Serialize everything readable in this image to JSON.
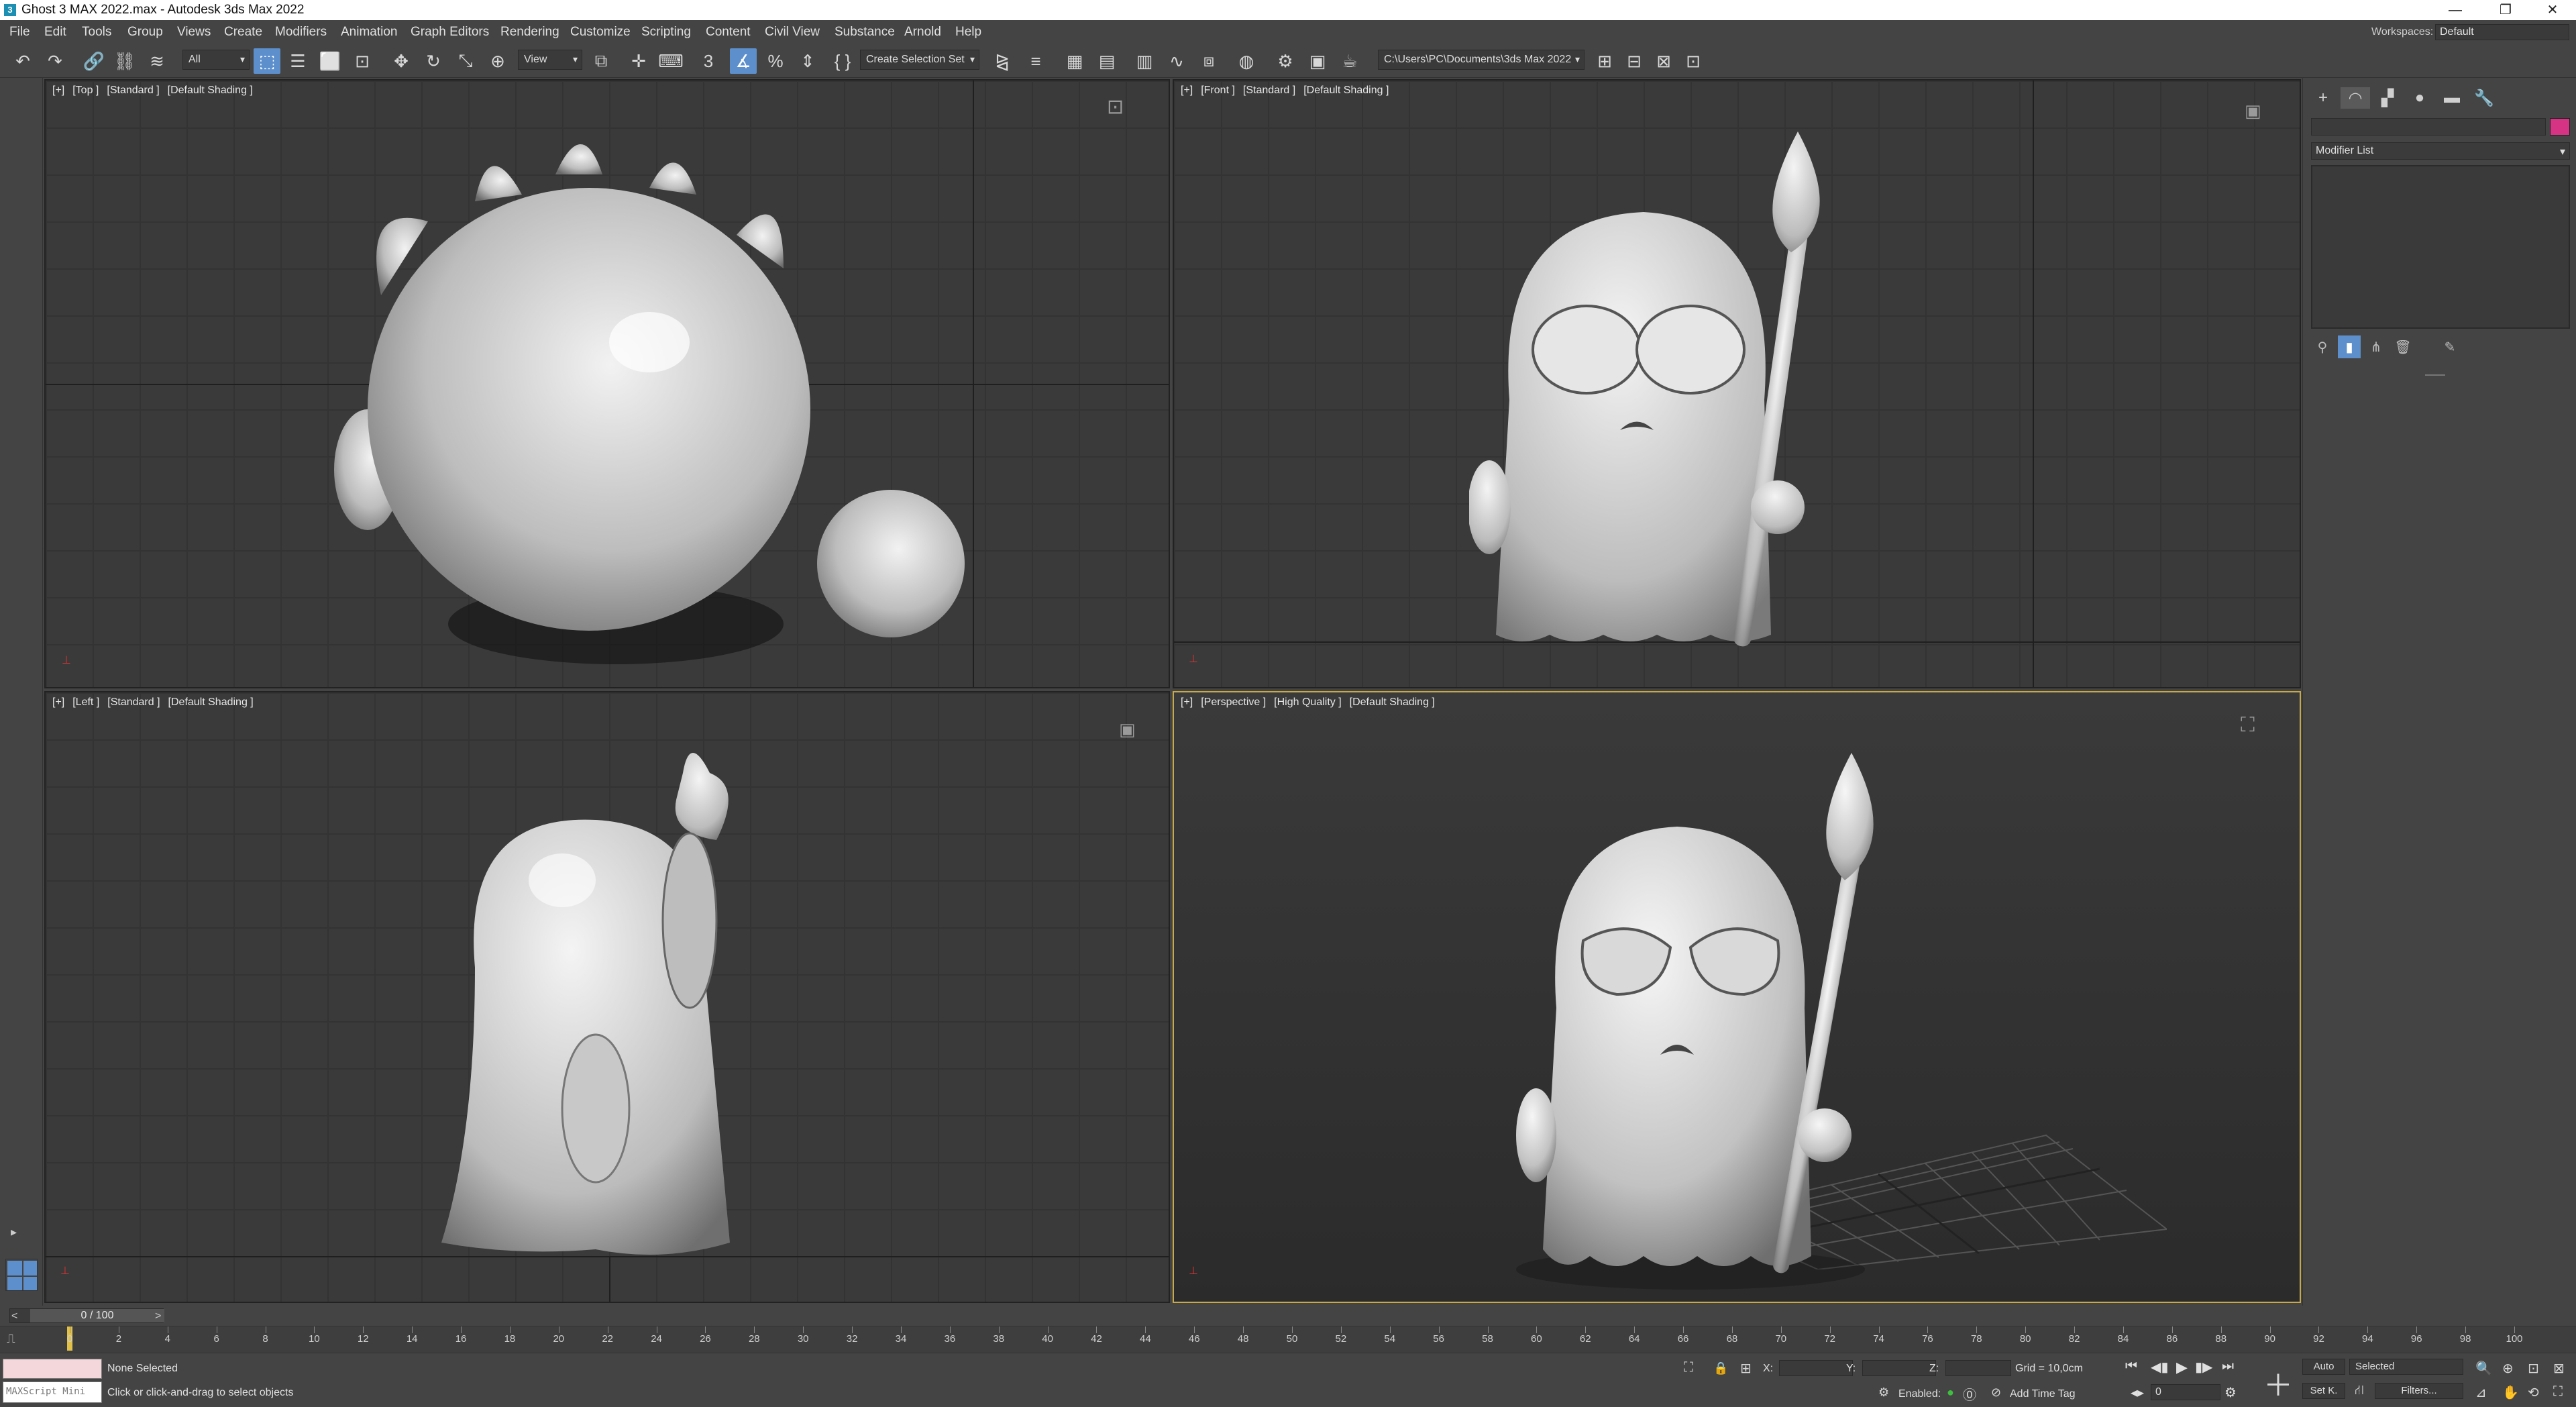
{
  "window": {
    "title": "Ghost 3 MAX 2022.max - Autodesk 3ds Max 2022",
    "app_icon": "3",
    "minimize": "—",
    "restore": "❐",
    "close": "✕"
  },
  "menu": {
    "items": [
      "File",
      "Edit",
      "Tools",
      "Group",
      "Views",
      "Create",
      "Modifiers",
      "Animation",
      "Graph Editors",
      "Rendering",
      "Customize",
      "Scripting",
      "Content",
      "Civil View",
      "Substance",
      "Arnold",
      "Help"
    ],
    "workspaces_label": "Workspaces:",
    "workspaces_value": "Default"
  },
  "toolbar": {
    "filter_value": "All",
    "refcoord_value": "View",
    "selection_set_placeholder": "Create Selection Set",
    "project_path": "C:\\Users\\PC\\Documents\\3ds Max 2022",
    "icons": {
      "undo": "↶",
      "redo": "↷",
      "link": "🔗",
      "unlink": "⛓",
      "bind": "≋",
      "select": "⬚",
      "select_by_name": "☰",
      "rect_region": "⬜",
      "window_crossing": "⊡",
      "move": "✥",
      "rotate": "↻",
      "scale": "⤡",
      "placement": "⊕",
      "use_pivot": "⧉",
      "move_pivot": "✛",
      "keyboard": "⌨",
      "snap3": "3",
      "angle_snap": "∡",
      "percent_snap": "%",
      "spinner_snap": "⇕",
      "edit_named": "{ }",
      "mirror": "⧎",
      "align": "≡",
      "scene_explorer": "▦",
      "layers": "▤",
      "ribbon": "▥",
      "curve_editor": "∿",
      "schematic": "⧈",
      "material_editor": "◍",
      "render_setup": "⚙",
      "frame_window": "▣",
      "render": "☕",
      "render_iter": "☕",
      "extra1": "⊞",
      "extra2": "⊟",
      "extra3": "⊠",
      "extra4": "⊡"
    }
  },
  "viewports": {
    "top": {
      "labels": [
        "[+]",
        "[Top ]",
        "[Standard ]",
        "[Default Shading ]"
      ]
    },
    "front": {
      "labels": [
        "[+]",
        "[Front ]",
        "[Standard ]",
        "[Default Shading ]"
      ]
    },
    "left": {
      "labels": [
        "[+]",
        "[Left ]",
        "[Standard ]",
        "[Default Shading ]"
      ]
    },
    "perspective": {
      "labels": [
        "[+]",
        "[Perspective ]",
        "[High Quality ]",
        "[Default Shading ]"
      ]
    }
  },
  "command_panel": {
    "modifier_list": "Modifier List",
    "tabs": [
      "+",
      "◠",
      "▞",
      "●",
      "▬",
      "🔧"
    ]
  },
  "timeline": {
    "slider_value": "0 / 100",
    "prev": "<",
    "next": ">",
    "tick_labels": [
      "0",
      "2",
      "4",
      "6",
      "8",
      "10",
      "12",
      "14",
      "16",
      "18",
      "20",
      "22",
      "24",
      "26",
      "28",
      "30",
      "32",
      "34",
      "36",
      "38",
      "40",
      "42",
      "44",
      "46",
      "48",
      "50",
      "52",
      "54",
      "56",
      "58",
      "60",
      "62",
      "64",
      "66",
      "68",
      "70",
      "72",
      "74",
      "76",
      "78",
      "80",
      "82",
      "84",
      "86",
      "88",
      "90",
      "92",
      "94",
      "96",
      "98",
      "100"
    ]
  },
  "status": {
    "maxscript_label": "MAXScript Mini",
    "selection": "None Selected",
    "prompt": "Click or click-and-drag to select objects",
    "x_label": "X:",
    "y_label": "Y:",
    "z_label": "Z:",
    "grid": "Grid = 10,0cm",
    "enabled_label": "Enabled:",
    "add_time_tag": "Add Time Tag",
    "auto_key": "Auto",
    "set_key": "Set K.",
    "key_mode_value": "Selected",
    "filters": "Filters...",
    "frame_value": "0"
  }
}
